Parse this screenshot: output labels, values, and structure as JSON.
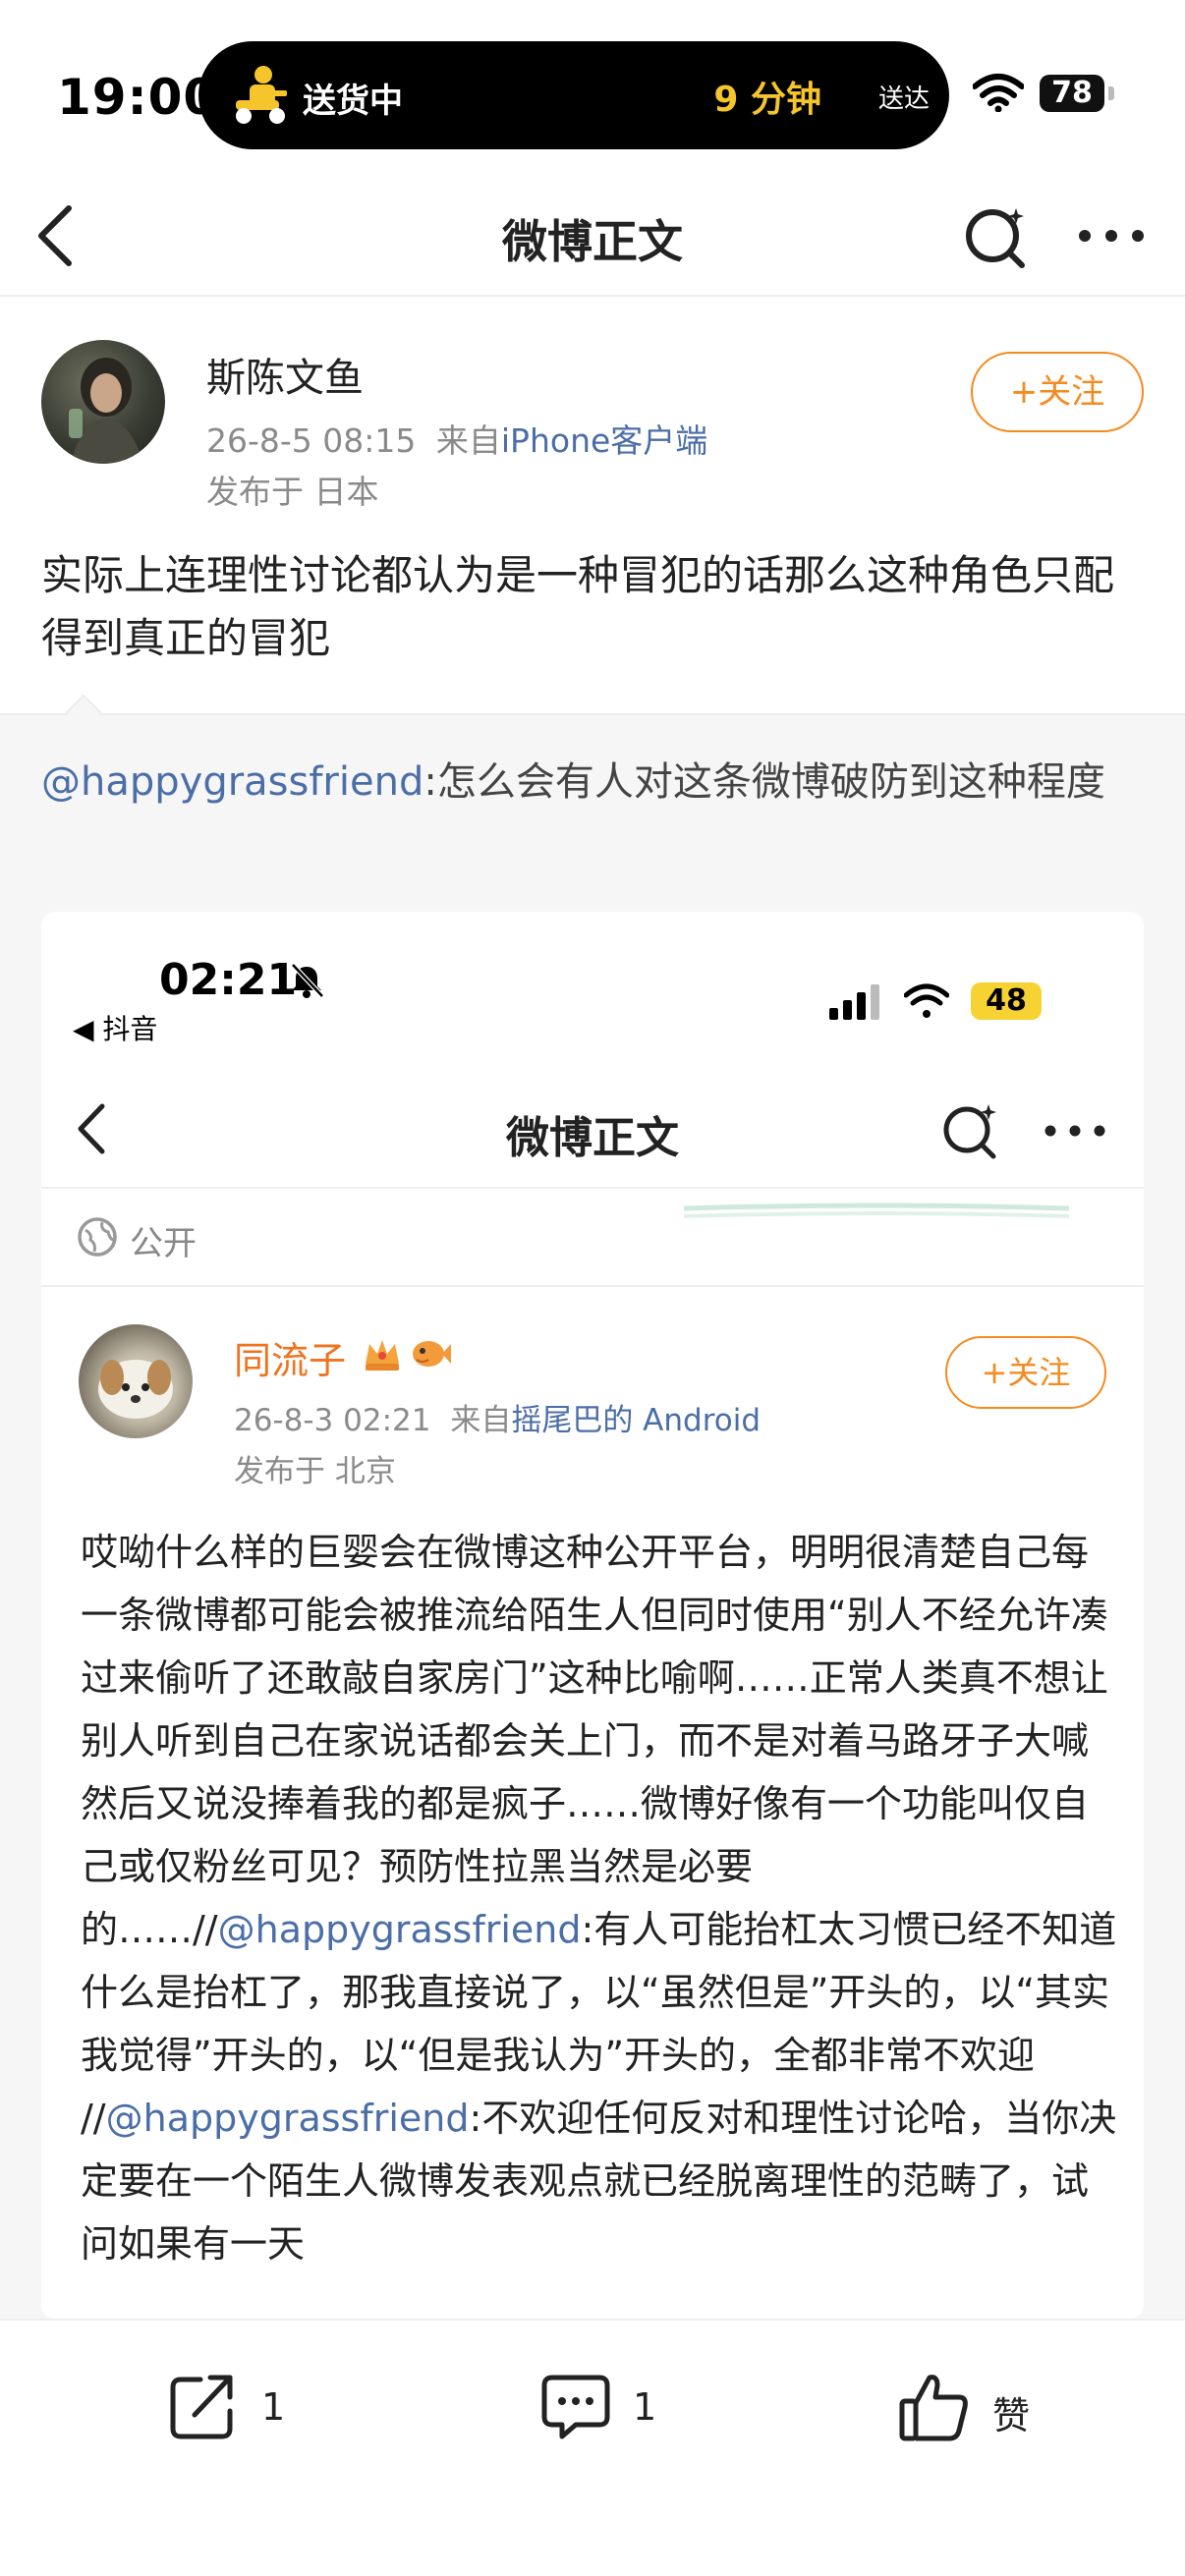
{
  "status_bar": {
    "time": "19:00",
    "island_label": "送货中",
    "island_eta": "9 分钟",
    "island_eta_suffix": "送达",
    "battery": "78"
  },
  "nav": {
    "title": "微博正文"
  },
  "post": {
    "author": "斯陈文鱼",
    "date": "26-8-5 08:15",
    "source_prefix": "来自",
    "source": "iPhone客户端",
    "location": "发布于 日本",
    "follow_label": "+关注",
    "text": "实际上连理性讨论都认为是一种冒犯的话那么这种角色只配得到真正的冒犯"
  },
  "repost": {
    "mention": "@happygrassfriend",
    "text": ":怎么会有人对这条微博破防到这种程度"
  },
  "embedded": {
    "time": "02:21",
    "back_app": "◀ 抖音",
    "battery": "48",
    "nav_title": "微博正文",
    "visibility": "公开",
    "author": "同流子",
    "date": "26-8-3 02:21",
    "source_prefix": "来自",
    "source": "摇尾巴的 Android",
    "location": "发布于 北京",
    "follow_label": "+关注",
    "body_part1": "哎呦什么样的巨婴会在微博这种公开平台，明明很清楚自己每一条微博都可能会被推流给陌生人但同时使用“别人不经允许凑过来偷听了还敢敲自家房门”这种比喻啊……正常人类真不想让别人听到自己在家说话都会关上门，而不是对着马路牙子大喊然后又说没捧着我的都是疯子……微博好像有一个功能叫仅自己或仅粉丝可见？预防性拉黑当然是必要的……//",
    "mention1": "@happygrassfriend",
    "body_part2": ":有人可能抬杠太习惯已经不知道什么是抬杠了，那我直接说了，以“虽然但是”开头的，以“其实我觉得”开头的，以“但是我认为”开头的，全都非常不欢迎 //",
    "mention2": "@happygrassfriend",
    "body_part3": ":不欢迎任何反对和理性讨论哈，当你决定要在一个陌生人微博发表观点就已经脱离理性的范畴了，试问如果有一天"
  },
  "toolbar": {
    "repost_count": "1",
    "comment_count": "1",
    "like_label": "赞"
  },
  "colors": {
    "accent_orange": "#f58a1f",
    "link_blue": "#4b6ea7",
    "eta_yellow": "#f6c52c"
  }
}
